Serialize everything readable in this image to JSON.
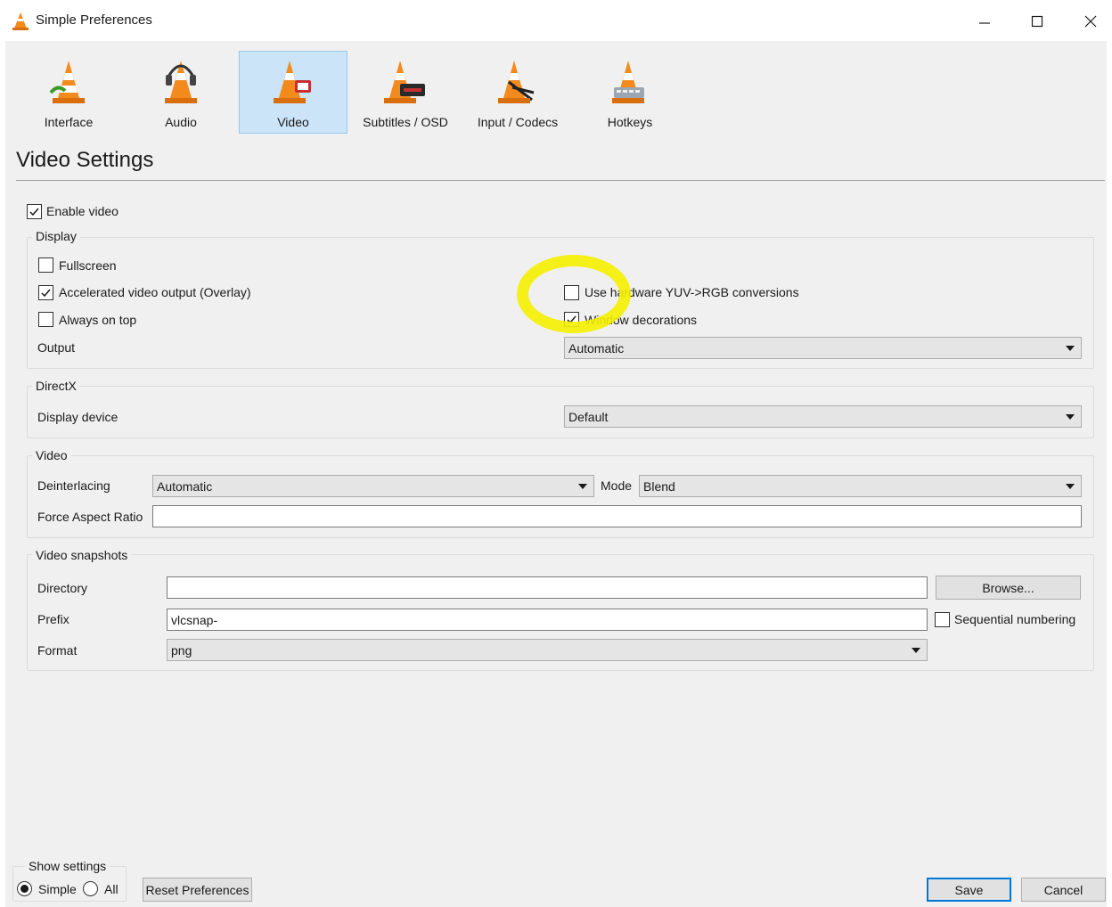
{
  "window": {
    "title": "Simple Preferences"
  },
  "categories": [
    {
      "label": "Interface",
      "icon": "interface-cone-icon"
    },
    {
      "label": "Audio",
      "icon": "audio-cone-headphones-icon"
    },
    {
      "label": "Video",
      "icon": "video-cone-icon",
      "active": true
    },
    {
      "label": "Subtitles / OSD",
      "icon": "subtitles-cone-icon"
    },
    {
      "label": "Input / Codecs",
      "icon": "input-codecs-cone-icon"
    },
    {
      "label": "Hotkeys",
      "icon": "hotkeys-cone-icon"
    }
  ],
  "page": {
    "title": "Video Settings",
    "enable_video": {
      "label": "Enable video",
      "checked": true
    }
  },
  "display": {
    "legend": "Display",
    "fullscreen": {
      "label": "Fullscreen",
      "checked": false
    },
    "accelerated": {
      "label": "Accelerated video output (Overlay)",
      "checked": true
    },
    "always_on_top": {
      "label": "Always on top",
      "checked": false
    },
    "hw_yuv": {
      "label": "Use hardware YUV->RGB conversions",
      "checked": false
    },
    "window_decorations": {
      "label": "Window decorations",
      "checked": true
    },
    "output_label": "Output",
    "output_value": "Automatic"
  },
  "directx": {
    "legend": "DirectX",
    "display_device_label": "Display device",
    "display_device_value": "Default"
  },
  "video": {
    "legend": "Video",
    "deinterlacing_label": "Deinterlacing",
    "deinterlacing_value": "Automatic",
    "mode_label": "Mode",
    "mode_value": "Blend",
    "aspect_label": "Force Aspect Ratio",
    "aspect_value": ""
  },
  "snapshots": {
    "legend": "Video snapshots",
    "directory_label": "Directory",
    "directory_value": "",
    "browse_label": "Browse...",
    "prefix_label": "Prefix",
    "prefix_value": "vlcsnap-",
    "sequential": {
      "label": "Sequential numbering",
      "checked": false
    },
    "format_label": "Format",
    "format_value": "png"
  },
  "footer": {
    "show_settings_legend": "Show settings",
    "simple_label": "Simple",
    "all_label": "All",
    "selected": "Simple",
    "reset_label": "Reset Preferences",
    "save_label": "Save",
    "cancel_label": "Cancel"
  },
  "colors": {
    "accent": "#0078d7",
    "active_tab": "#cce4f7",
    "cone_orange": "#f28a1e",
    "highlight_marker": "#f5f000"
  }
}
